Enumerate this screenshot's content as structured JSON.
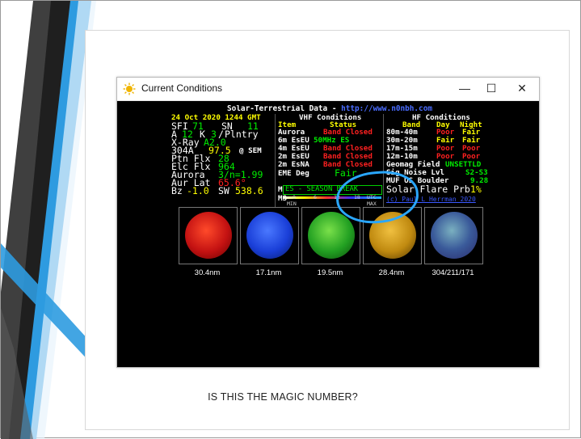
{
  "window": {
    "title": "Current Conditions"
  },
  "panel": {
    "header_title": "Solar-Terrestrial Data - ",
    "header_url": "http://www.n0nbh.com",
    "date": "24 Oct 2020 1244 GMT",
    "solar": {
      "sfi_label": "SFI",
      "sfi_value": "71",
      "sn_label": "SN",
      "sn_value": "11",
      "a_label": "A",
      "a_value": "12",
      "k_label": "K",
      "k_value": "3",
      "k_sep": "/",
      "k_extra": "Plntry",
      "xray_label": "X-Ray",
      "xray_value": "A2.0",
      "a304_label": "304A",
      "a304_value": "97.5",
      "a304_suffix": "@ SEM",
      "ptn_label": "Ptn Flx",
      "ptn_value": "28",
      "elc_label": "Elc Flx",
      "elc_value": "964",
      "aurora_label": "Aurora",
      "aurora_value": "3/n=1.99",
      "aurlat_label": "Aur Lat",
      "aurlat_value": "65.6°",
      "bz_label": "Bz",
      "bz_value": "-1.0",
      "sw_label": "SW",
      "sw_value": "538.6"
    },
    "vhf": {
      "title": "VHF Conditions",
      "col_item": "Item",
      "col_status": "Status",
      "rows": [
        {
          "item": "Aurora",
          "status": "Band Closed"
        },
        {
          "item": "6m EsEU",
          "status": "50MHz ES"
        },
        {
          "item": "4m EsEU",
          "status": "Band Closed"
        },
        {
          "item": "2m EsEU",
          "status": "Band Closed"
        },
        {
          "item": "2m EsNA",
          "status": "Band Closed"
        }
      ],
      "eme_label": "EME Deg",
      "eme_value": "Fair",
      "muf_label": "MUF",
      "muf_value": "ES - SEASON BREAK",
      "ms_label": "MS",
      "ms_scale": [
        "0",
        "6",
        "12",
        "18",
        "UTC"
      ],
      "ms_min": "MIN",
      "ms_max": "MAX"
    },
    "hf": {
      "title": "HF Conditions",
      "col_band": "Band",
      "col_day": "Day",
      "col_night": "Night",
      "rows": [
        {
          "band": "80m-40m",
          "day": "Poor",
          "night": "Fair"
        },
        {
          "band": "30m-20m",
          "day": "Fair",
          "night": "Fair"
        },
        {
          "band": "17m-15m",
          "day": "Poor",
          "night": "Poor"
        },
        {
          "band": "12m-10m",
          "day": "Poor",
          "night": "Poor"
        }
      ],
      "geomag_label": "Geomag Field",
      "geomag_value": "UNSETTLD",
      "sig_label": "Sig Noise Lvl",
      "sig_value": "S2-S3",
      "muf_label": "MUF US Boulder",
      "muf_value": "9.28",
      "flare_label": "Solar Flare Prb",
      "flare_value": "1%",
      "footer": "(c) Paul L Herrman 2020"
    }
  },
  "sun_images": [
    {
      "label": "30.4nm",
      "color": "#d11a1a"
    },
    {
      "label": "17.1nm",
      "color": "#1a3fd8"
    },
    {
      "label": "19.5nm",
      "color": "#22b022"
    },
    {
      "label": "28.4nm",
      "color": "#d8a01a"
    },
    {
      "label": "304/211/171",
      "color": "#2a4a8a"
    }
  ],
  "caption": "IS THIS THE MAGIC NUMBER?",
  "colors": {
    "accent_blue": "#1e90ff",
    "annotation": "#2aa7ff"
  }
}
